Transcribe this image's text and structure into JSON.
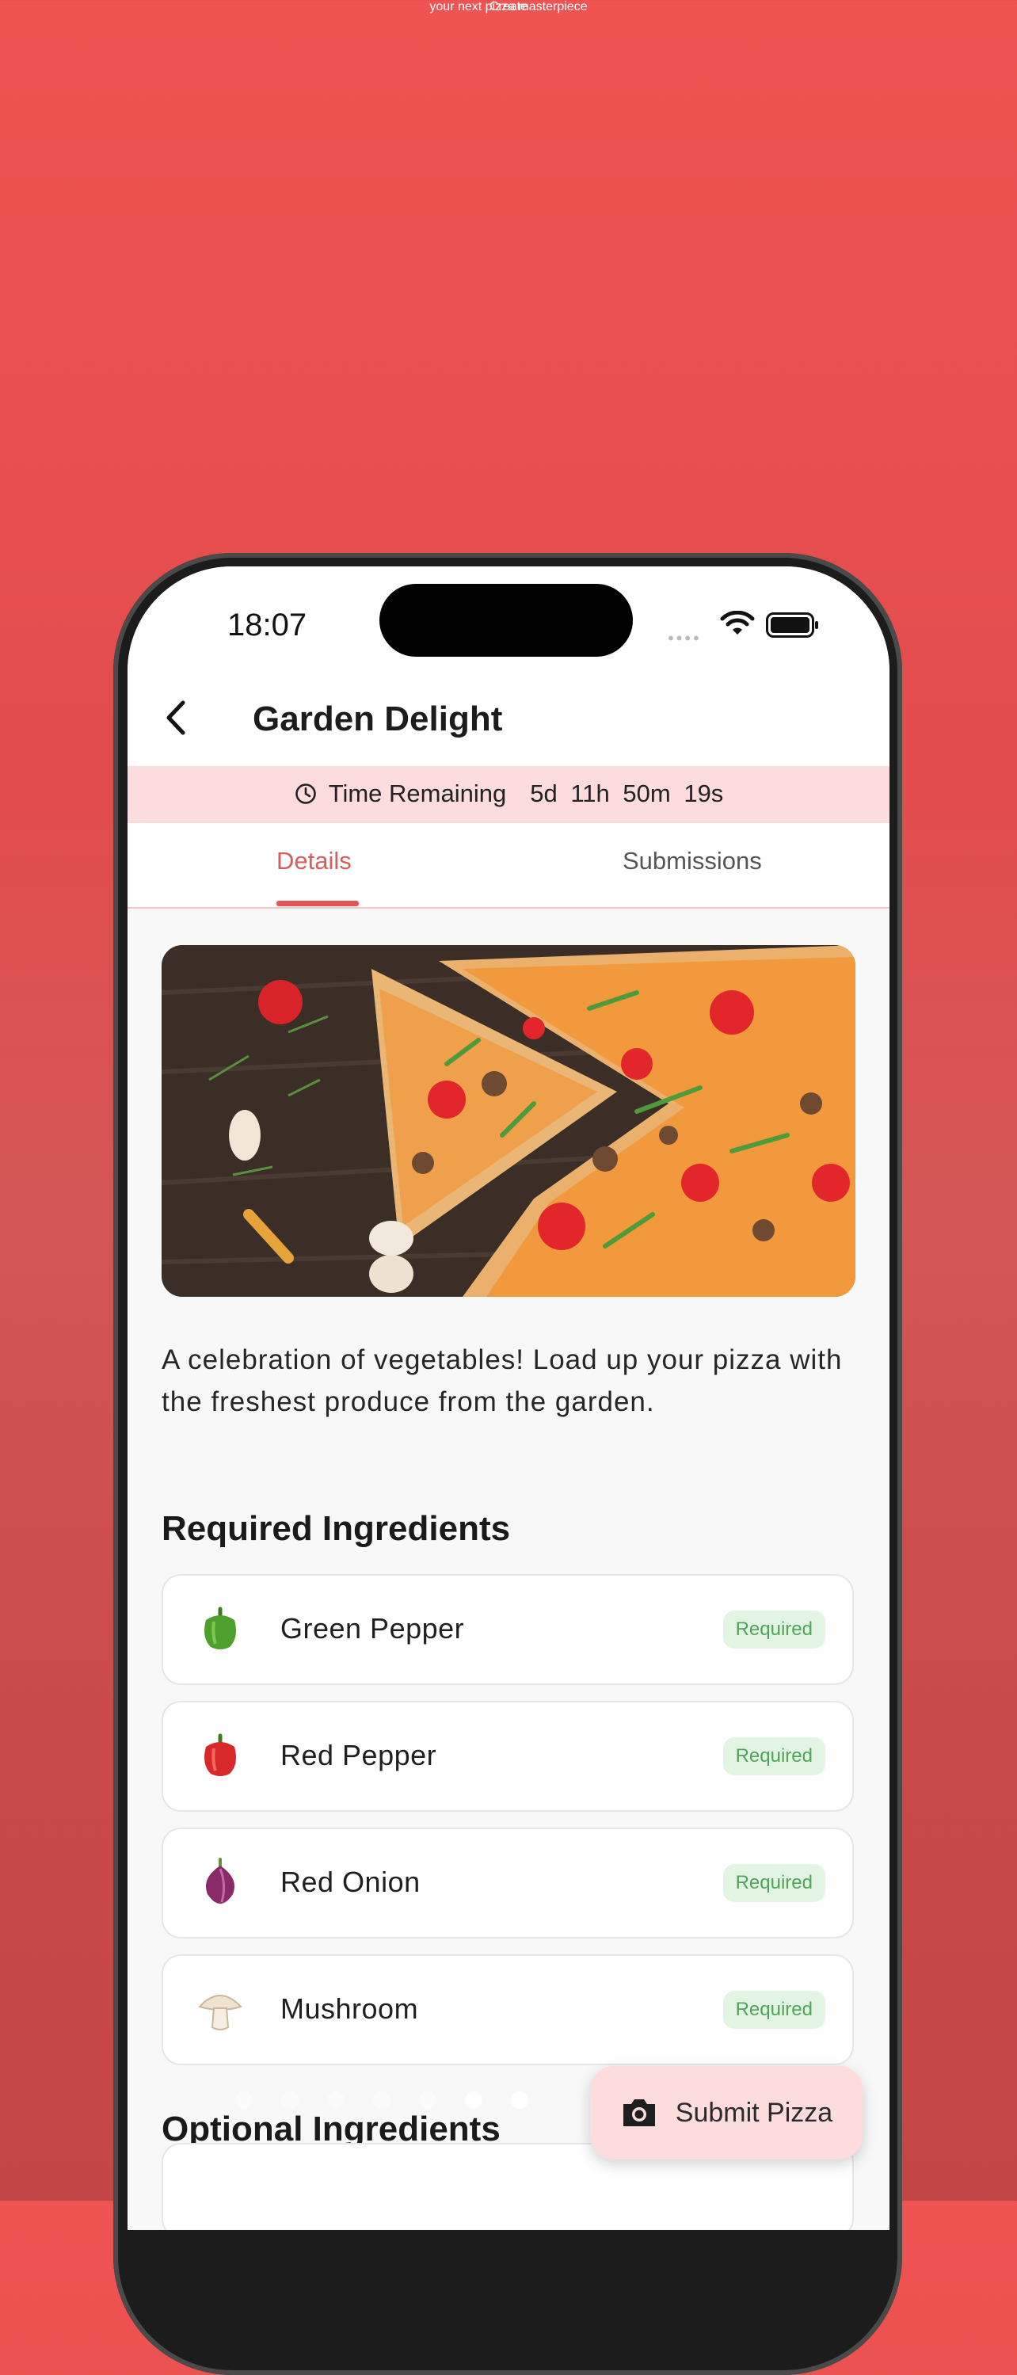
{
  "promo": {
    "title": "Create",
    "subtitle": "your next pizza masterpiece"
  },
  "status_bar": {
    "time": "18:07"
  },
  "navbar": {
    "title": "Garden Delight"
  },
  "timer": {
    "label": "Time Remaining",
    "days": "5d",
    "hours": "11h",
    "minutes": "50m",
    "seconds": "19s"
  },
  "tabs": [
    {
      "label": "Details",
      "active": true
    },
    {
      "label": "Submissions",
      "active": false
    }
  ],
  "description": "A celebration of vegetables! Load up your pizza with the freshest produce from the garden.",
  "required_section": {
    "title": "Required Ingredients",
    "items": [
      {
        "name": "Green Pepper",
        "badge": "Required",
        "icon": "green-pepper-icon"
      },
      {
        "name": "Red Pepper",
        "badge": "Required",
        "icon": "red-pepper-icon"
      },
      {
        "name": "Red Onion",
        "badge": "Required",
        "icon": "red-onion-icon"
      },
      {
        "name": "Mushroom",
        "badge": "Required",
        "icon": "mushroom-icon"
      }
    ]
  },
  "optional_section": {
    "title": "Optional Ingredients"
  },
  "submit_button": {
    "label": "Submit Pizza",
    "icon": "camera-icon"
  },
  "colors": {
    "accent": "#e15757",
    "timer_bg": "#fcdcdc",
    "badge_bg": "#e2f4e2",
    "badge_text": "#52a35a"
  },
  "pagination": {
    "total": 7,
    "active_index": 5
  }
}
